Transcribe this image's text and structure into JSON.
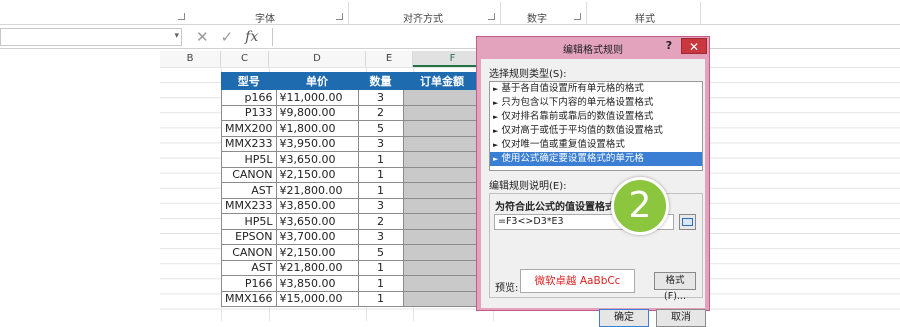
{
  "ribbon": {
    "groups": [
      "字体",
      "对齐方式",
      "数字",
      "样式"
    ]
  },
  "formula_bar": {
    "cancel_icon": "✕",
    "enter_icon": "✓",
    "fx_label": "fx"
  },
  "columns": [
    "B",
    "C",
    "D",
    "E",
    "F",
    "G"
  ],
  "table": {
    "headers": [
      "型号",
      "单价",
      "数量",
      "订单金额"
    ],
    "rows": [
      {
        "model": "p166",
        "price": "¥11,000.00",
        "qty": "3"
      },
      {
        "model": "P133",
        "price": "¥9,800.00",
        "qty": "2"
      },
      {
        "model": "MMX200",
        "price": "¥1,800.00",
        "qty": "5"
      },
      {
        "model": "MMX233",
        "price": "¥3,950.00",
        "qty": "3"
      },
      {
        "model": "HP5L",
        "price": "¥3,650.00",
        "qty": "1"
      },
      {
        "model": "CANON",
        "price": "¥2,150.00",
        "qty": "1"
      },
      {
        "model": "AST",
        "price": "¥21,800.00",
        "qty": "1"
      },
      {
        "model": "MMX233",
        "price": "¥3,850.00",
        "qty": "3"
      },
      {
        "model": "HP5L",
        "price": "¥3,650.00",
        "qty": "2"
      },
      {
        "model": "EPSON",
        "price": "¥3,700.00",
        "qty": "3"
      },
      {
        "model": "CANON",
        "price": "¥2,150.00",
        "qty": "5"
      },
      {
        "model": "AST",
        "price": "¥21,800.00",
        "qty": "1"
      },
      {
        "model": "P166",
        "price": "¥3,850.00",
        "qty": "1"
      },
      {
        "model": "MMX166",
        "price": "¥15,000.00",
        "qty": "1"
      }
    ]
  },
  "dialog": {
    "title": "编辑格式规则",
    "help": "?",
    "close": "✕",
    "select_rule_type_label": "选择规则类型(S):",
    "rule_types": [
      "基于各自值设置所有单元格的格式",
      "只为包含以下内容的单元格设置格式",
      "仅对排名靠前或靠后的数值设置格式",
      "仅对高于或低于平均值的数值设置格式",
      "仅对唯一值或重复值设置格式",
      "使用公式确定要设置格式的单元格"
    ],
    "selected_rule_index": 5,
    "edit_desc_label": "编辑规则说明(E):",
    "formula_label": "为符合此公式的值设置格式(O):",
    "formula_value": "=F3<>D3*E3",
    "preview_label": "预览:",
    "preview_text": "微软卓越  AaBbCc",
    "format_button": "格式(F)...",
    "ok_button": "确定",
    "cancel_button": "取消"
  },
  "step_badge": "2",
  "colors": {
    "header_blue": "#1f6bb0",
    "dialog_frame": "#e3a3bd",
    "selected_rule": "#3b7fd4",
    "badge_green": "#8cc63f",
    "preview_red": "#dd2222"
  }
}
